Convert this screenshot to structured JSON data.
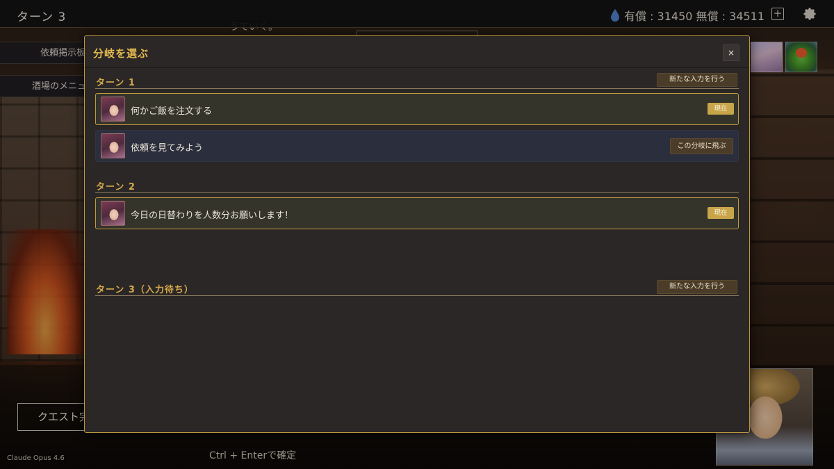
{
  "topbar": {
    "turn_title": "ターン 3",
    "currency_text": "有償 : 31450 無償 : 34511",
    "plus_label": "+"
  },
  "background": {
    "partial_text": "うていく。",
    "side_menu": [
      "依頼掲示板",
      "酒場のメニュ"
    ],
    "quest_button": "クエスト完",
    "ctrl_hint": "Ctrl + Enterで確定",
    "model_label": "Claude Opus 4.6"
  },
  "modal": {
    "title": "分岐を選ぶ",
    "close_label": "×",
    "turns": [
      {
        "label": "ターン 1",
        "action": "新たな入力を行う",
        "branches": [
          {
            "text": "何かご飯を注文する",
            "status": "現在"
          },
          {
            "text": "依頼を見てみよう",
            "action": "この分岐に飛ぶ"
          }
        ]
      },
      {
        "label": "ターン 2",
        "branches": [
          {
            "text": "今日の日替わりを人数分お願いします！",
            "status": "現在"
          }
        ]
      },
      {
        "label": "ターン 3（入力待ち）",
        "action": "新たな入力を行う",
        "branches": []
      }
    ]
  },
  "colors": {
    "accent_gold": "#c29a3e",
    "title_gold": "#e2b94e",
    "modal_bg": "#2b2727",
    "alt_branch_bg": "#2b2e3c"
  },
  "icons": [
    "water-drop-icon",
    "plus-icon",
    "gear-icon",
    "close-icon"
  ]
}
